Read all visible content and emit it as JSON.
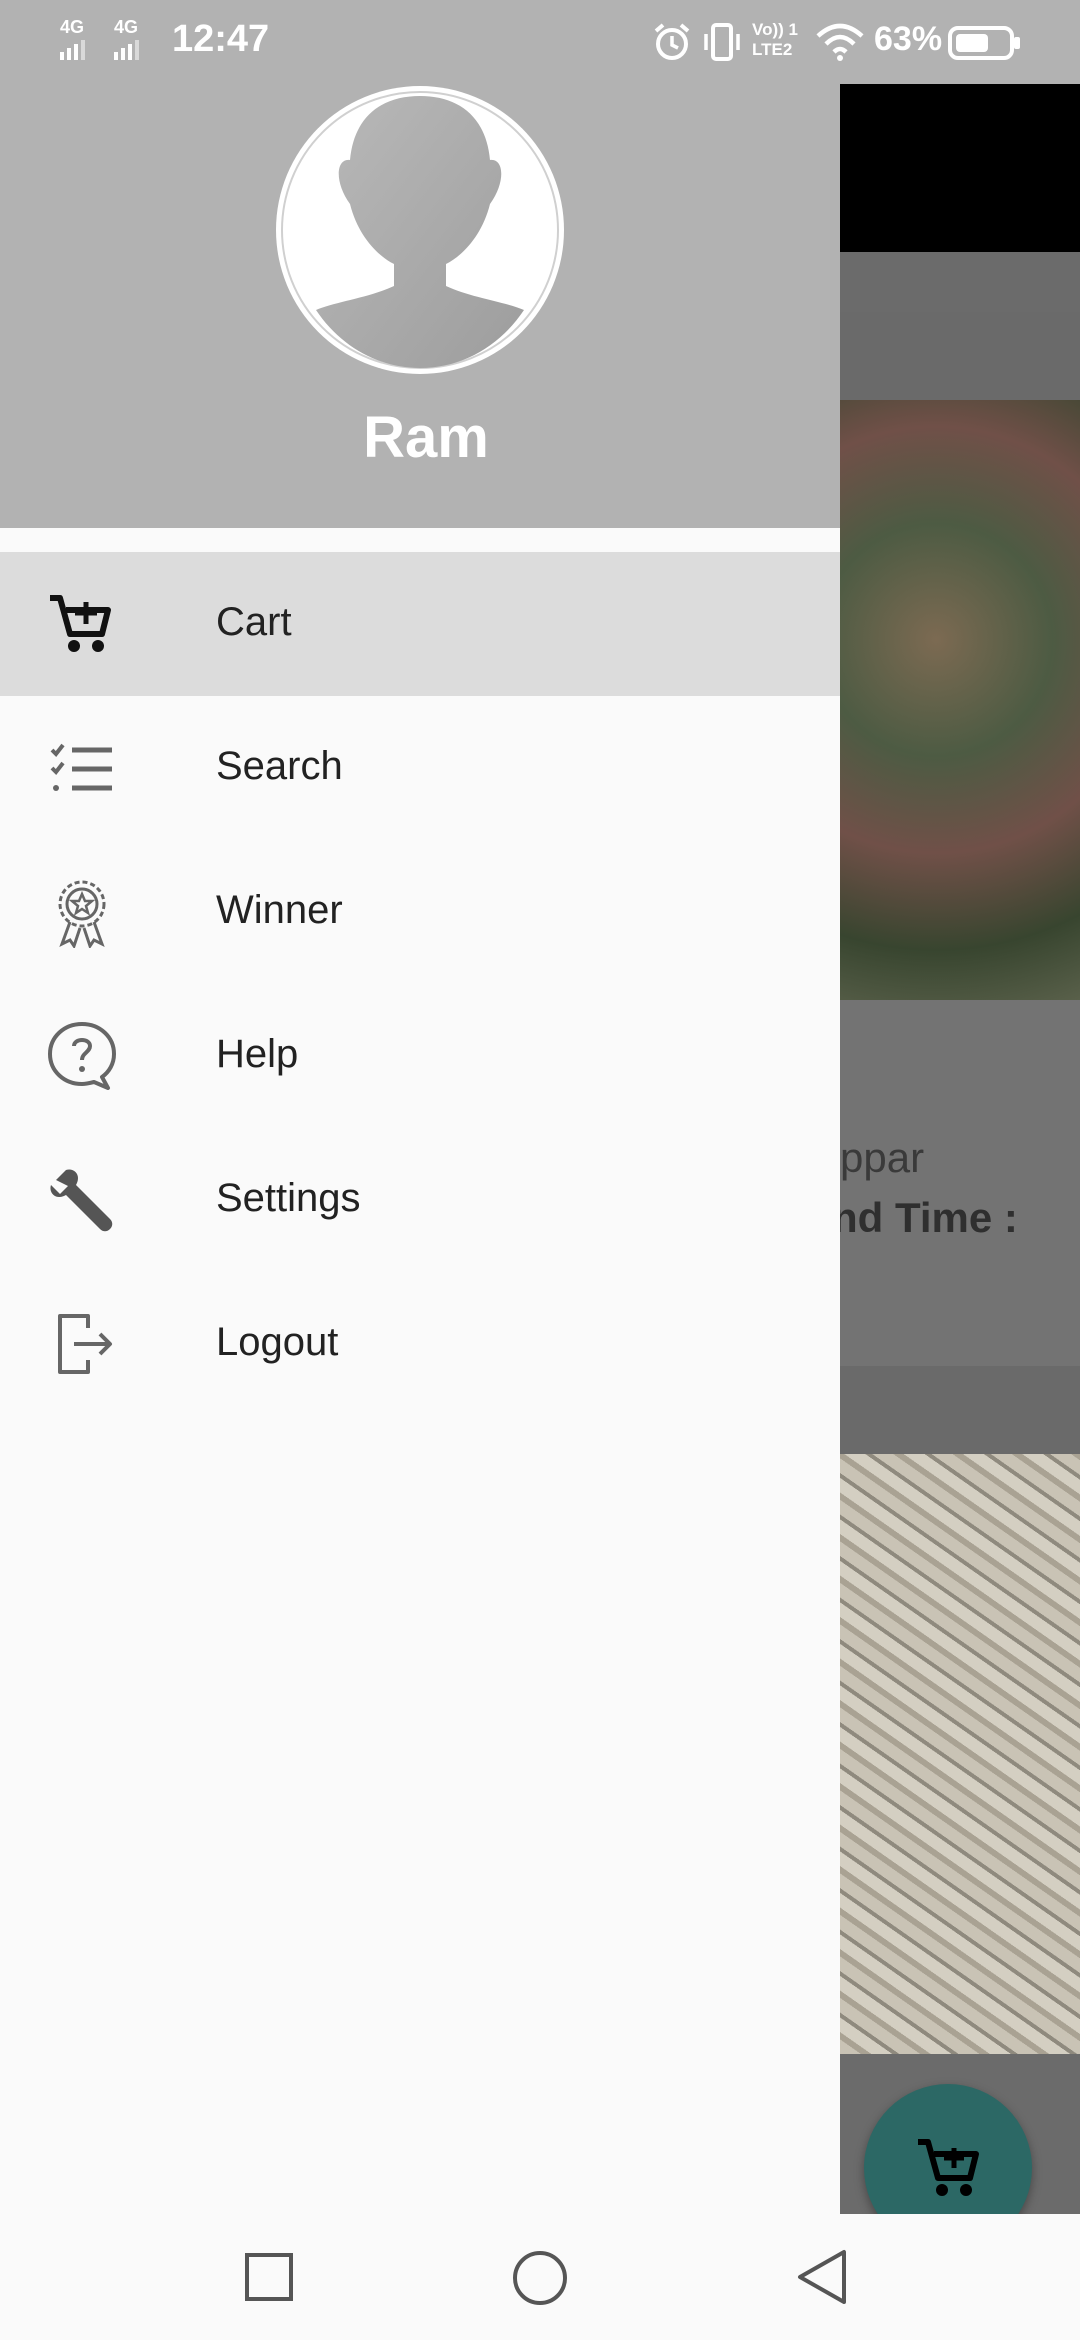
{
  "status_bar": {
    "network_1": "4G",
    "network_2": "4G",
    "time": "12:47",
    "volte": "Vo)) 1",
    "lte": "LTE2",
    "battery": "63%"
  },
  "drawer": {
    "user_name": "Ram",
    "menu": [
      {
        "label": "Cart",
        "icon": "cart-icon",
        "active": true
      },
      {
        "label": "Search",
        "icon": "checklist-icon",
        "active": false
      },
      {
        "label": "Winner",
        "icon": "award-ribbon-icon",
        "active": false
      },
      {
        "label": "Help",
        "icon": "help-bubble-icon",
        "active": false
      },
      {
        "label": "Settings",
        "icon": "wrench-icon",
        "active": false
      },
      {
        "label": "Logout",
        "icon": "logout-icon",
        "active": false
      }
    ]
  },
  "background": {
    "partial_text_1": "ppar",
    "partial_text_2": "nd Time :"
  },
  "colors": {
    "header_bg": "#b2b2b2",
    "active_item_bg": "#dcdcdc",
    "fab_bg": "#2c6865"
  }
}
